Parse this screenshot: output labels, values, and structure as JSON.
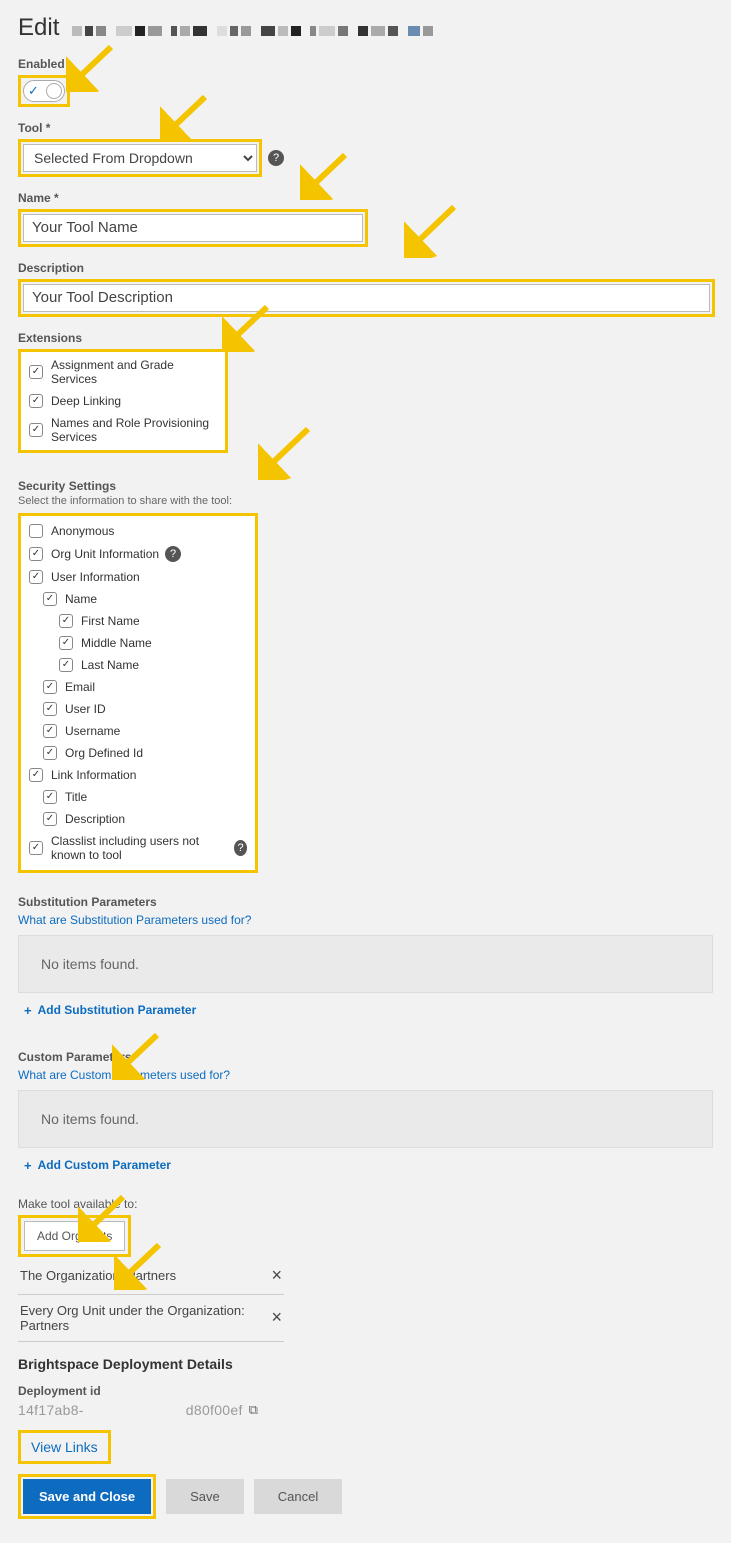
{
  "title": "Edit",
  "enabled_label": "Enabled",
  "tool": {
    "label": "Tool *",
    "selected": "Selected From Dropdown"
  },
  "name": {
    "label": "Name *",
    "value": "Your Tool Name"
  },
  "description": {
    "label": "Description",
    "value": "Your Tool Description"
  },
  "extensions": {
    "label": "Extensions",
    "items": [
      {
        "label": "Assignment and Grade Services",
        "checked": true
      },
      {
        "label": "Deep Linking",
        "checked": true
      },
      {
        "label": "Names and Role Provisioning Services",
        "checked": true
      }
    ]
  },
  "security": {
    "label": "Security Settings",
    "sub": "Select the information to share with the tool:",
    "items": [
      {
        "label": "Anonymous",
        "checked": false,
        "indent": 0,
        "help": false
      },
      {
        "label": "Org Unit Information",
        "checked": true,
        "indent": 0,
        "help": true
      },
      {
        "label": "User Information",
        "checked": true,
        "indent": 0,
        "help": false
      },
      {
        "label": "Name",
        "checked": true,
        "indent": 1,
        "help": false
      },
      {
        "label": "First Name",
        "checked": true,
        "indent": 2,
        "help": false
      },
      {
        "label": "Middle Name",
        "checked": true,
        "indent": 2,
        "help": false
      },
      {
        "label": "Last Name",
        "checked": true,
        "indent": 2,
        "help": false
      },
      {
        "label": "Email",
        "checked": true,
        "indent": 1,
        "help": false
      },
      {
        "label": "User ID",
        "checked": true,
        "indent": 1,
        "help": false
      },
      {
        "label": "Username",
        "checked": true,
        "indent": 1,
        "help": false
      },
      {
        "label": "Org Defined Id",
        "checked": true,
        "indent": 1,
        "help": false
      },
      {
        "label": "Link Information",
        "checked": true,
        "indent": 0,
        "help": false
      },
      {
        "label": "Title",
        "checked": true,
        "indent": 1,
        "help": false
      },
      {
        "label": "Description",
        "checked": true,
        "indent": 1,
        "help": false
      },
      {
        "label": "Classlist including users not known to tool",
        "checked": true,
        "indent": 0,
        "help": true
      }
    ]
  },
  "subparams": {
    "title": "Substitution Parameters",
    "help": "What are Substitution Parameters used for?",
    "empty": "No items found.",
    "add": "Add Substitution Parameter"
  },
  "custparams": {
    "title": "Custom Parameters",
    "help": "What are Custom Parameters used for?",
    "empty": "No items found.",
    "add": "Add Custom Parameter"
  },
  "avail": {
    "label": "Make tool available to:",
    "add_btn": "Add Org Units",
    "rows": [
      "The Organization: Partners",
      "Every Org Unit under the Organization: Partners"
    ]
  },
  "deploy": {
    "title": "Brightspace Deployment Details",
    "id_label": "Deployment id",
    "id_left": "14f17ab8-",
    "id_right": "d80f00ef"
  },
  "view_links": "View Links",
  "buttons": {
    "save_close": "Save and Close",
    "save": "Save",
    "cancel": "Cancel"
  },
  "colors": {
    "highlight": "#f5c400",
    "primary": "#0d6cbf"
  }
}
